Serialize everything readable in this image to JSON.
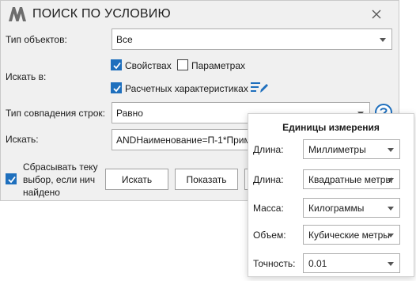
{
  "dialog": {
    "title": "ПОИСК ПО УСЛОВИЮ",
    "object_type_label": "Тип объектов:",
    "object_type_value": "Все",
    "search_in_label": "Искать в:",
    "properties_label": "Свойствах",
    "properties_checked": true,
    "parameters_label": "Параметрах",
    "parameters_checked": false,
    "calculated_label": "Расчетных характеристиках",
    "calculated_checked": true,
    "match_type_label": "Тип совпадения строк:",
    "match_type_value": "Равно",
    "search_label": "Искать:",
    "search_value": "ANDНаименование=П-1*Прим",
    "reset_line1": "Сбрасывать теку",
    "reset_line2": "выбор, если нич",
    "reset_line3": "найдено",
    "reset_checked": true,
    "find_button": "Искать",
    "show_button": "Показать"
  },
  "units_popup": {
    "title": "Единицы измерения",
    "rows": [
      {
        "label": "Длина:",
        "value": "Миллиметры"
      },
      {
        "label": "Длина:",
        "value": "Квадратные метры"
      },
      {
        "label": "Масса:",
        "value": "Килограммы"
      },
      {
        "label": "Объем:",
        "value": "Кубические метры"
      },
      {
        "label": "Точность:",
        "value": "0.01"
      }
    ]
  },
  "colors": {
    "accent": "#1e6fbd",
    "logo": "#6d6d6d",
    "help_icon": "#1e6fbd"
  },
  "icons": [
    "app-logo-icon",
    "close-icon",
    "checkmark-icon",
    "edit-list-icon",
    "help-icon",
    "chevron-down-icon"
  ]
}
